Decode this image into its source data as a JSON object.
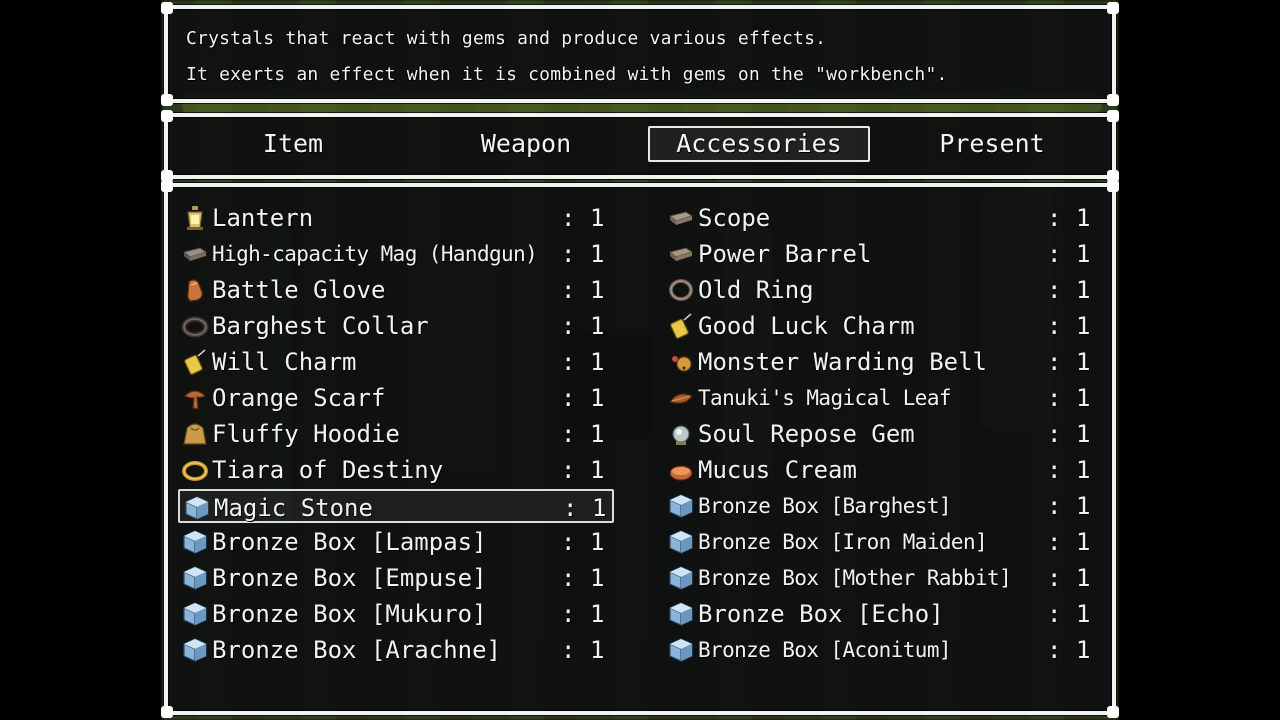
{
  "help": {
    "line1": "Crystals that react with gems and produce various effects.",
    "line2": "It exerts an effect when it is combined with gems on the \"workbench\"."
  },
  "tabs": [
    {
      "label": "Item",
      "active": false
    },
    {
      "label": "Weapon",
      "active": false
    },
    {
      "label": "Accessories",
      "active": true
    },
    {
      "label": "Present",
      "active": false
    }
  ],
  "colon": ":",
  "items": [
    {
      "name": "Lantern",
      "qty": "1",
      "icon": "lantern-icon",
      "selected": false
    },
    {
      "name": "Scope",
      "qty": "1",
      "icon": "scope-icon",
      "selected": false
    },
    {
      "name": "High-capacity Mag (Handgun)",
      "qty": "1",
      "icon": "magazine-icon",
      "selected": false
    },
    {
      "name": "Power Barrel",
      "qty": "1",
      "icon": "barrel-icon",
      "selected": false
    },
    {
      "name": "Battle Glove",
      "qty": "1",
      "icon": "glove-icon",
      "selected": false
    },
    {
      "name": "Old Ring",
      "qty": "1",
      "icon": "ring-icon",
      "selected": false
    },
    {
      "name": "Barghest Collar",
      "qty": "1",
      "icon": "collar-icon",
      "selected": false
    },
    {
      "name": "Good Luck Charm",
      "qty": "1",
      "icon": "charm-icon",
      "selected": false
    },
    {
      "name": "Will Charm",
      "qty": "1",
      "icon": "charm-icon",
      "selected": false
    },
    {
      "name": "Monster Warding Bell",
      "qty": "1",
      "icon": "bell-icon",
      "selected": false
    },
    {
      "name": "Orange Scarf",
      "qty": "1",
      "icon": "scarf-icon",
      "selected": false
    },
    {
      "name": "Tanuki's Magical Leaf",
      "qty": "1",
      "icon": "leaf-icon",
      "selected": false
    },
    {
      "name": "Fluffy Hoodie",
      "qty": "1",
      "icon": "hoodie-icon",
      "selected": false
    },
    {
      "name": "Soul Repose Gem",
      "qty": "1",
      "icon": "gem-icon",
      "selected": false
    },
    {
      "name": "Tiara of Destiny",
      "qty": "1",
      "icon": "tiara-icon",
      "selected": false
    },
    {
      "name": "Mucus Cream",
      "qty": "1",
      "icon": "cream-icon",
      "selected": false
    },
    {
      "name": "Magic Stone",
      "qty": "1",
      "icon": "box-icon",
      "selected": true
    },
    {
      "name": "Bronze Box [Barghest]",
      "qty": "1",
      "icon": "box-icon",
      "selected": false
    },
    {
      "name": "Bronze Box [Lampas]",
      "qty": "1",
      "icon": "box-icon",
      "selected": false
    },
    {
      "name": "Bronze Box [Iron Maiden]",
      "qty": "1",
      "icon": "box-icon",
      "selected": false
    },
    {
      "name": "Bronze Box [Empuse]",
      "qty": "1",
      "icon": "box-icon",
      "selected": false
    },
    {
      "name": "Bronze Box [Mother Rabbit]",
      "qty": "1",
      "icon": "box-icon",
      "selected": false
    },
    {
      "name": "Bronze Box [Mukuro]",
      "qty": "1",
      "icon": "box-icon",
      "selected": false
    },
    {
      "name": "Bronze Box [Echo]",
      "qty": "1",
      "icon": "box-icon",
      "selected": false
    },
    {
      "name": "Bronze Box [Arachne]",
      "qty": "1",
      "icon": "box-icon",
      "selected": false
    },
    {
      "name": "Bronze Box [Aconitum]",
      "qty": "1",
      "icon": "box-icon",
      "selected": false
    }
  ]
}
